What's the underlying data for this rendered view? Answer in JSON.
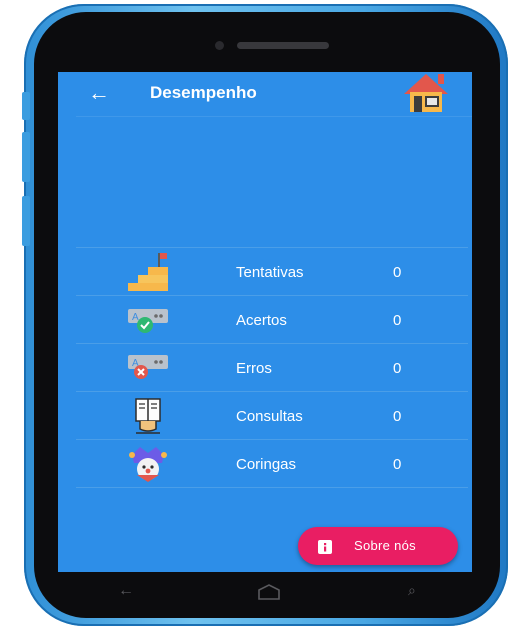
{
  "appbar": {
    "title": "Desempenho",
    "back_icon": "arrow-left-icon",
    "home_icon": "house-icon"
  },
  "stats": [
    {
      "icon": "stairs-flag-icon",
      "label": "Tentativas",
      "value": "0"
    },
    {
      "icon": "answer-correct-icon",
      "label": "Acertos",
      "value": "0"
    },
    {
      "icon": "answer-wrong-icon",
      "label": "Erros",
      "value": "0"
    },
    {
      "icon": "open-book-icon",
      "label": "Consultas",
      "value": "0"
    },
    {
      "icon": "jester-icon",
      "label": "Coringas",
      "value": "0"
    }
  ],
  "fab": {
    "label": "Sobre nós",
    "icon": "info-icon"
  },
  "colors": {
    "screen_bg": "#2d8ee8",
    "fab_bg": "#e91e63",
    "text": "#ffffff"
  }
}
